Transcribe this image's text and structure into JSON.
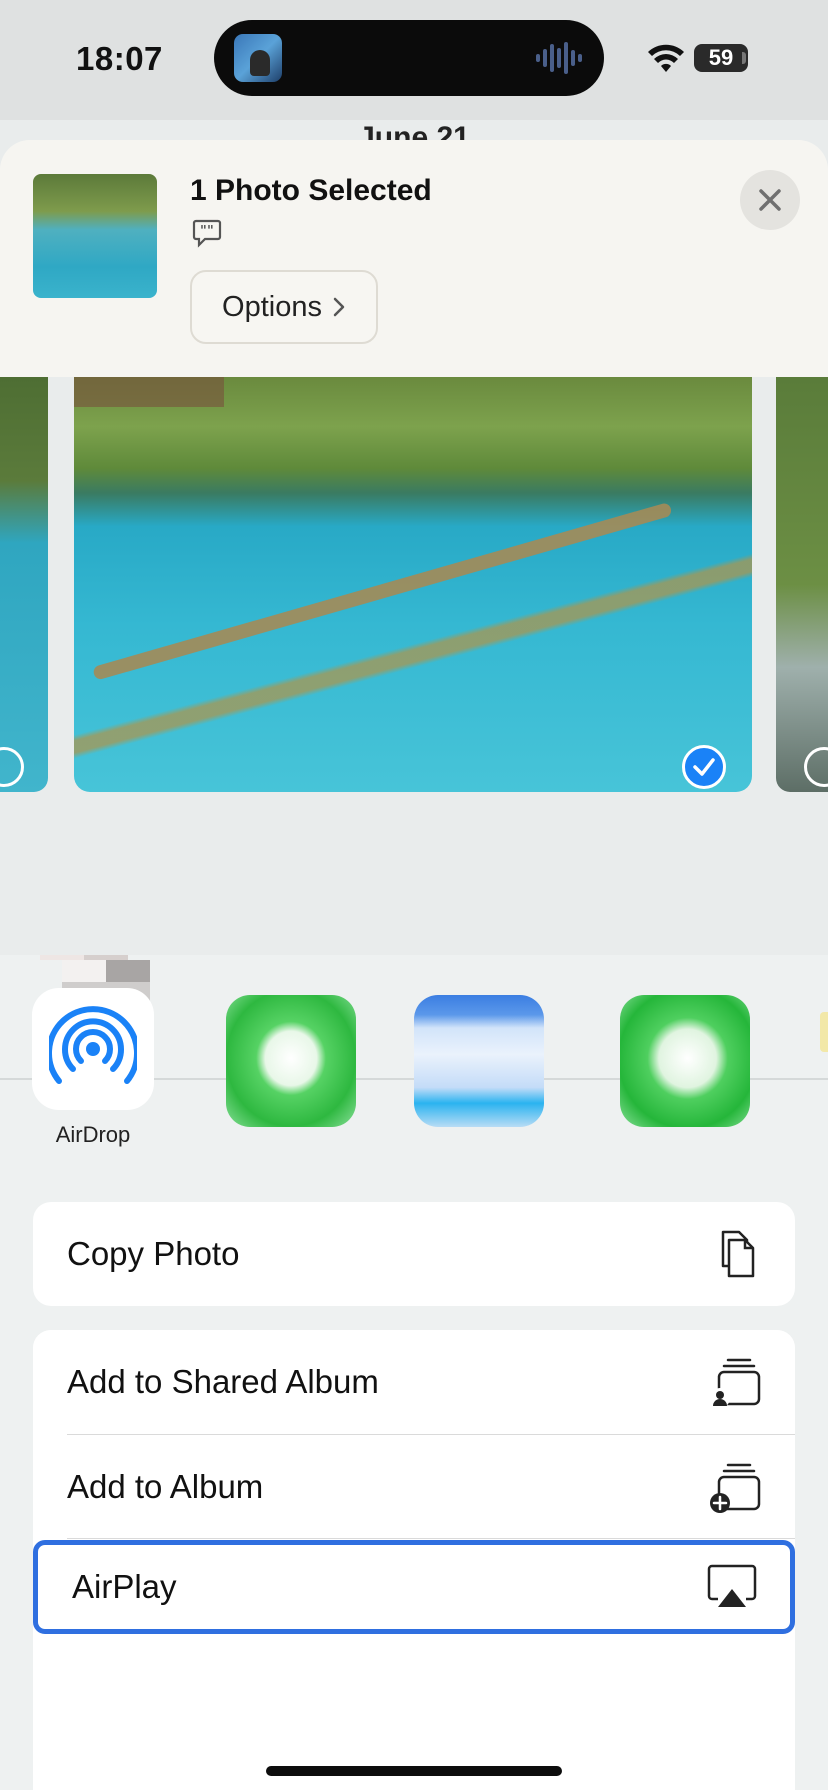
{
  "status_bar": {
    "time": "18:07",
    "battery": "59",
    "icons": [
      "now-playing-art",
      "audio-wave-icon",
      "wifi-icon",
      "battery-icon"
    ]
  },
  "background": {
    "date_peek": "June 21"
  },
  "share_sheet": {
    "title": "1 Photo Selected",
    "options_label": "Options",
    "close_icon": "close-icon",
    "caption_icon": "quote-bubble-icon"
  },
  "apps": {
    "airdrop_label": "AirDrop"
  },
  "actions": {
    "copy_photo": "Copy Photo",
    "add_to_shared_album": "Add to Shared Album",
    "add_to_album": "Add to Album",
    "airplay": "AirPlay"
  },
  "colors": {
    "accent": "#1a82f7",
    "focus_ring": "#2f6fe0"
  }
}
